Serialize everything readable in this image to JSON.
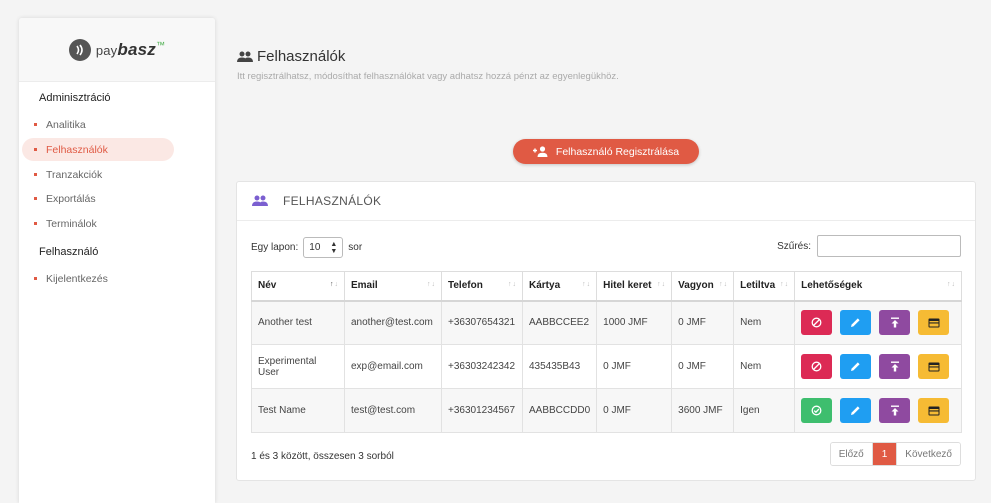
{
  "brand": {
    "pre": "pay",
    "main": "basz",
    "tm": "™"
  },
  "sidebar": {
    "section_admin": "Adminisztráció",
    "items": [
      {
        "label": "Analitika"
      },
      {
        "label": "Felhasználók",
        "active": true
      },
      {
        "label": "Tranzakciók"
      },
      {
        "label": "Exportálás"
      },
      {
        "label": "Terminálok"
      }
    ],
    "section_user": "Felhasználó",
    "user_items": [
      {
        "label": "Kijelentkezés"
      }
    ]
  },
  "header": {
    "title": "Felhasználók",
    "subtitle": "Itt regisztrálhatsz, módosíthat felhasználókat vagy adhatsz hozzá pénzt az egyenlegükhöz."
  },
  "register_button": "Felhasználó Regisztrálása",
  "card": {
    "title": "FELHASZNÁLÓK",
    "length_prefix": "Egy lapon:",
    "length_value": "10",
    "length_suffix": "sor",
    "filter_label": "Szűrés:",
    "filter_value": ""
  },
  "table": {
    "columns": [
      "Név",
      "Email",
      "Telefon",
      "Kártya",
      "Hitel keret",
      "Vagyon",
      "Letiltva",
      "Lehetőségek"
    ],
    "rows": [
      {
        "name": "Another test",
        "email": "another@test.com",
        "phone": "+36307654321",
        "card": "AABBCCEE2",
        "credit": "1000 JMF",
        "balance": "0 JMF",
        "blocked": "Nem",
        "status_action": "block"
      },
      {
        "name": "Experimental User",
        "email": "exp@email.com",
        "phone": "+36303242342",
        "card": "435435B43",
        "credit": "0 JMF",
        "balance": "0 JMF",
        "blocked": "Nem",
        "status_action": "block"
      },
      {
        "name": "Test Name",
        "email": "test@test.com",
        "phone": "+36301234567",
        "card": "AABBCCDD0",
        "credit": "0 JMF",
        "balance": "3600 JMF",
        "blocked": "Igen",
        "status_action": "unblock"
      }
    ]
  },
  "footer": {
    "info": "1 és 3 között, összesen 3 sorból",
    "prev": "Előző",
    "current_page": "1",
    "next": "Következő"
  },
  "colors": {
    "accent": "#e05a44",
    "block": "#dc2a55",
    "unblock": "#3ebe6e",
    "edit": "#1f9ef2",
    "topup": "#8f4aa0",
    "card": "#f6bb34",
    "card_header_icon": "#7b5fd0"
  }
}
